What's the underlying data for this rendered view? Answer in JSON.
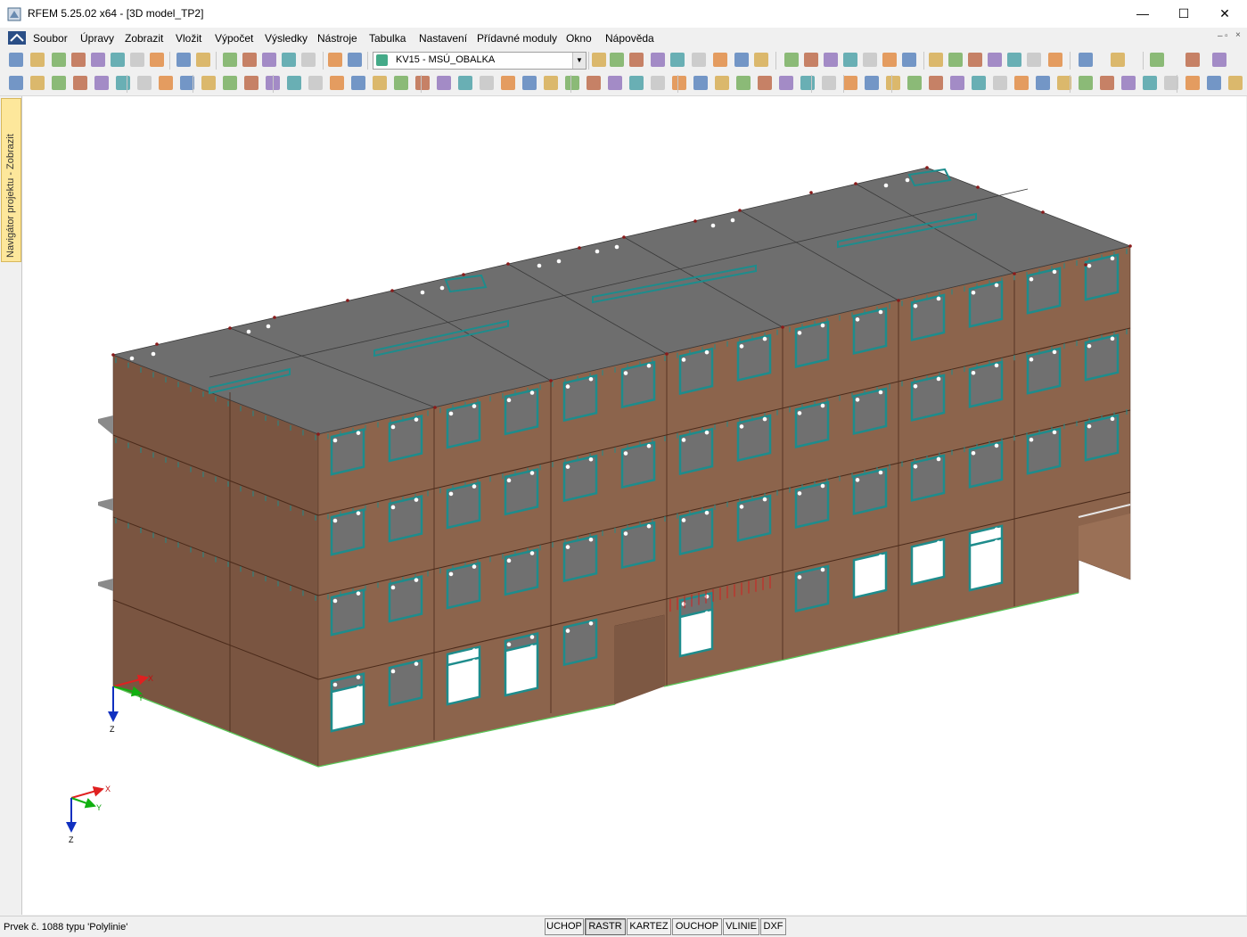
{
  "window": {
    "title": "RFEM 5.25.02 x64 - [3D model_TP2]"
  },
  "title_buttons": {
    "minimize": "—",
    "maximize": "☐",
    "close": "✕"
  },
  "menu": [
    "Soubor",
    "Úpravy",
    "Zobrazit",
    "Vložit",
    "Výpočet",
    "Výsledky",
    "Nástroje",
    "Tabulka",
    "Nastavení",
    "Přídavné moduly",
    "Okno",
    "Nápověda"
  ],
  "load_combo": {
    "value": "KV15 - MSÚ_OBALKA"
  },
  "navigator": {
    "label": "Navigátor projektu - Zobrazit"
  },
  "axes": {
    "x": "X",
    "y": "Y",
    "z": "Z"
  },
  "status": {
    "text": "Prvek č. 1088 typu 'Polylinie'",
    "buttons": [
      "UCHOP",
      "RASTR",
      "KARTEZ",
      "OUCHOP",
      "VLINIE",
      "DXF"
    ],
    "active": "RASTR"
  },
  "colors": {
    "facade": "#8c644c",
    "facade_dark": "#7a5541",
    "roof": "#6e6e6e",
    "window_frame": "#1e8c8c",
    "accent": "#0078d7"
  }
}
